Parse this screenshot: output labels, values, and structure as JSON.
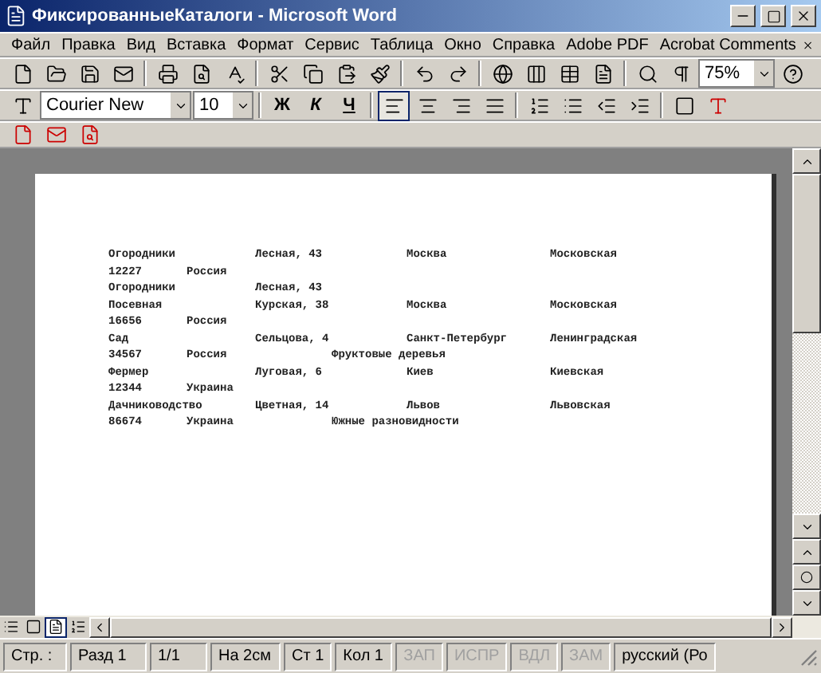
{
  "window": {
    "title": "ФиксированныеКаталоги - Microsoft Word"
  },
  "menu": [
    "Файл",
    "Правка",
    "Вид",
    "Вставка",
    "Формат",
    "Сервис",
    "Таблица",
    "Окно",
    "Справка",
    "Adobe PDF",
    "Acrobat Comments"
  ],
  "standard_toolbar": {
    "zoom": "75%"
  },
  "formatting_toolbar": {
    "font": "Courier New",
    "size": "10",
    "style_buttons": [
      "Ж",
      "К",
      "Ч"
    ],
    "align_buttons": [
      {
        "selected": true
      },
      {
        "selected": false
      },
      {
        "selected": false
      },
      {
        "selected": false
      }
    ]
  },
  "document": {
    "lines": [
      {
        "column_1": "Огородники",
        "column_3": "Лесная, 43",
        "column_5": "Москва",
        "column_6": "Московская"
      },
      {
        "column_1": "12227",
        "column_2": "Россия"
      },
      {
        "column_1": "Огородники",
        "column_3": "Лесная, 43"
      },
      {
        "column_1": "Посевная",
        "column_3": "Курская, 38",
        "column_5": "Москва",
        "column_6": "Московская"
      },
      {
        "column_1": "16656",
        "column_2": "Россия"
      },
      {
        "column_1": "Сад",
        "column_3": "Сельцова, 4",
        "column_5": "Санкт-Петербург",
        "column_6": "Ленинградская"
      },
      {
        "column_1": "34567",
        "column_2": "Россия",
        "column_4": "Фруктовые деревья"
      },
      {
        "column_1": "Фермер",
        "column_3": "Луговая, 6",
        "column_5": "Киев",
        "column_6": "Киевская"
      },
      {
        "column_1": "12344",
        "column_2": "Украина"
      },
      {
        "column_1": "Дачниководство",
        "column_3": "Цветная, 14",
        "column_5": "Львов",
        "column_6": "Львовская"
      },
      {
        "column_1": "86674",
        "column_2": "Украина",
        "column_4": "Южные разновидности"
      }
    ]
  },
  "view_buttons": [
    {
      "selected": false
    },
    {
      "selected": false
    },
    {
      "selected": true
    },
    {
      "selected": false
    }
  ],
  "status_bar": [
    {
      "text": "Стр. :",
      "disabled": false
    },
    {
      "text": "Разд 1",
      "disabled": false
    },
    {
      "text": "1/1",
      "disabled": false
    },
    {
      "text": "На 2см",
      "disabled": false
    },
    {
      "text": "Ст 1",
      "disabled": false
    },
    {
      "text": "Кол 1",
      "disabled": false
    },
    {
      "text": "ЗАП",
      "disabled": true
    },
    {
      "text": "ИСПР",
      "disabled": true
    },
    {
      "text": "ВДЛ",
      "disabled": true
    },
    {
      "text": "ЗАМ",
      "disabled": true
    },
    {
      "text": "русский (Ро",
      "disabled": false
    }
  ]
}
